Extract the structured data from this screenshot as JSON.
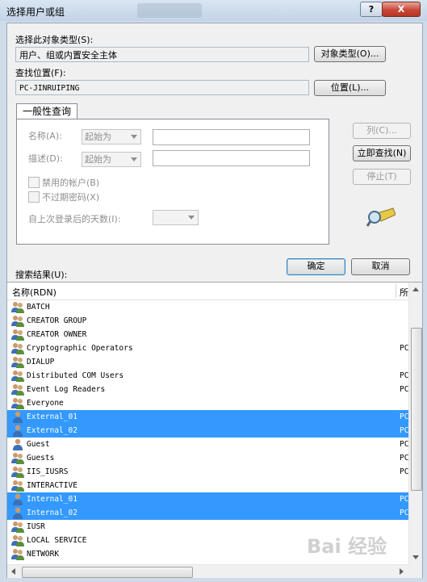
{
  "window": {
    "title": "选择用户或组",
    "help_label": "?",
    "close_label": "X"
  },
  "object_type": {
    "label": "选择此对象类型(S):",
    "value": "用户、组或内置安全主体",
    "button": "对象类型(O)..."
  },
  "location": {
    "label": "查找位置(F):",
    "value": "PC-JINRUIPING",
    "button": "位置(L)..."
  },
  "query_tab": {
    "label": "一般性查询",
    "name_label": "名称(A):",
    "name_mode": "起始为",
    "desc_label": "描述(D):",
    "desc_mode": "起始为",
    "disabled_accounts": "禁用的帐户(B)",
    "non_expiring_pw": "不过期密码(X)",
    "days_label": "自上次登录后的天数(I):"
  },
  "side_buttons": {
    "columns": "列(C)...",
    "find_now": "立即查找(N)",
    "stop": "停止(T)"
  },
  "actions": {
    "ok": "确定",
    "cancel": "取消"
  },
  "results": {
    "label": "搜索结果(U):",
    "columns": [
      "名称(RDN)",
      "所"
    ],
    "rows": [
      {
        "name": "BATCH",
        "folder": "",
        "icon": "group-icon",
        "selected": false
      },
      {
        "name": "CREATOR GROUP",
        "folder": "",
        "icon": "group-icon",
        "selected": false
      },
      {
        "name": "CREATOR OWNER",
        "folder": "",
        "icon": "group-icon",
        "selected": false
      },
      {
        "name": "Cryptographic Operators",
        "folder": "PC",
        "icon": "group-icon",
        "selected": false
      },
      {
        "name": "DIALUP",
        "folder": "",
        "icon": "group-icon",
        "selected": false
      },
      {
        "name": "Distributed COM Users",
        "folder": "PC",
        "icon": "group-icon",
        "selected": false
      },
      {
        "name": "Event Log Readers",
        "folder": "PC",
        "icon": "group-icon",
        "selected": false
      },
      {
        "name": "Everyone",
        "folder": "",
        "icon": "group-icon",
        "selected": false
      },
      {
        "name": "External_01",
        "folder": "PC",
        "icon": "user-icon",
        "selected": true
      },
      {
        "name": "External_02",
        "folder": "PC",
        "icon": "user-icon",
        "selected": true
      },
      {
        "name": "Guest",
        "folder": "PC",
        "icon": "user-icon",
        "selected": false
      },
      {
        "name": "Guests",
        "folder": "PC",
        "icon": "group-icon",
        "selected": false
      },
      {
        "name": "IIS_IUSRS",
        "folder": "PC",
        "icon": "group-icon",
        "selected": false
      },
      {
        "name": "INTERACTIVE",
        "folder": "",
        "icon": "group-icon",
        "selected": false
      },
      {
        "name": "Internal_01",
        "folder": "PC",
        "icon": "user-icon",
        "selected": true
      },
      {
        "name": "Internal_02",
        "folder": "PC",
        "icon": "user-icon",
        "selected": true
      },
      {
        "name": "IUSR",
        "folder": "",
        "icon": "group-icon",
        "selected": false
      },
      {
        "name": "LOCAL SERVICE",
        "folder": "",
        "icon": "group-icon",
        "selected": false
      },
      {
        "name": "NETWORK",
        "folder": "",
        "icon": "group-icon",
        "selected": false
      }
    ]
  },
  "watermark": "Bai 经验",
  "colors": {
    "selection": "#3399ff",
    "title_bar": "#cfdbe8",
    "close_button": "#c8483a"
  }
}
